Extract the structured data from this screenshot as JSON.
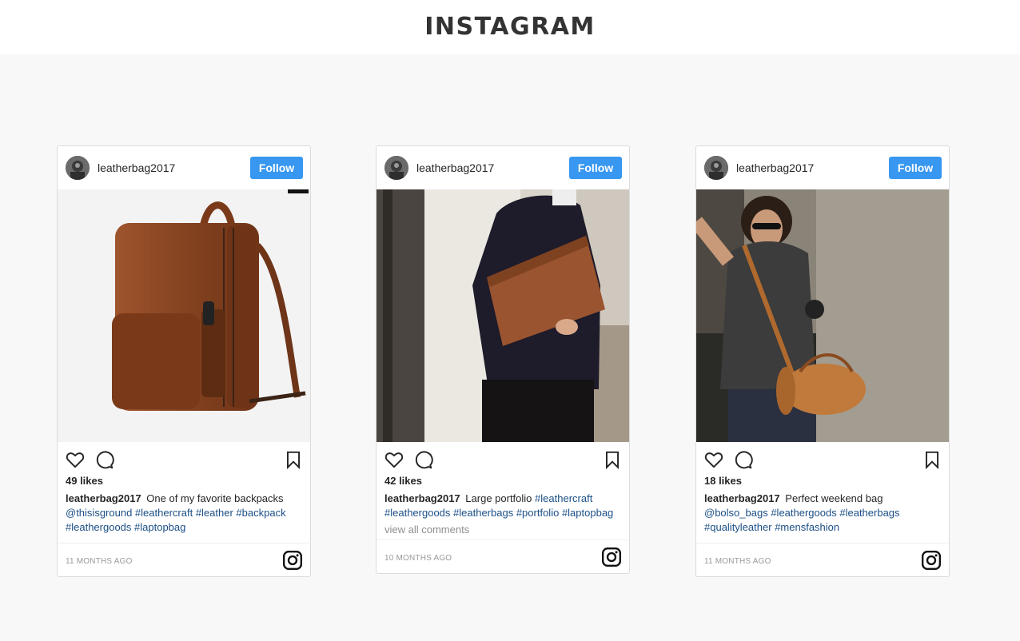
{
  "header": {
    "title": "INSTAGRAM"
  },
  "posts": [
    {
      "username": "leatherbag2017",
      "follow_label": "Follow",
      "likes": "49 likes",
      "caption_text": "One of my favorite backpacks",
      "tags": [
        "@thisisground",
        "#leathercraft",
        "#leather",
        "#backpack",
        "#leathergoods",
        "#laptopbag"
      ],
      "time": "11 MONTHS AGO"
    },
    {
      "username": "leatherbag2017",
      "follow_label": "Follow",
      "likes": "42 likes",
      "caption_text": "Large portfolio",
      "tags": [
        "#leathercraft",
        "#leathergoods",
        "#leatherbags",
        "#portfolio",
        "#laptopbag"
      ],
      "view_all": "view all comments",
      "time": "10 MONTHS AGO"
    },
    {
      "username": "leatherbag2017",
      "follow_label": "Follow",
      "likes": "18 likes",
      "caption_text": "Perfect weekend bag",
      "tags": [
        "@bolso_bags",
        "#leathergoods",
        "#leatherbags",
        "#qualityleather",
        "#mensfashion"
      ],
      "time": "11 MONTHS AGO"
    }
  ],
  "icons": {
    "like": "heart-icon",
    "comment": "comment-icon",
    "save": "bookmark-icon",
    "brand": "instagram-icon"
  },
  "colors": {
    "follow": "#3897f0",
    "hashtag": "#1c4f86",
    "background": "#f8f8f8"
  }
}
